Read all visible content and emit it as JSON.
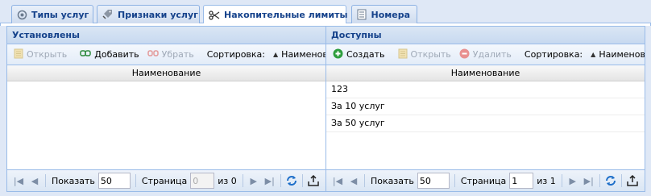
{
  "tabs": [
    {
      "label": "Типы услуг",
      "icon": "gear-icon"
    },
    {
      "label": "Признаки услуг",
      "icon": "tags-icon"
    },
    {
      "label": "Накопительные лимиты",
      "icon": "scissors-icon"
    },
    {
      "label": "Номера",
      "icon": "document-icon"
    }
  ],
  "left": {
    "title": "Установлены",
    "toolbar": {
      "open": "Открыть",
      "add": "Добавить",
      "remove": "Убрать",
      "sort": "Сортировка:",
      "sort_field": "Наименован"
    },
    "column": "Наименование",
    "rows": [],
    "pager": {
      "show": "Показать",
      "page_size": "50",
      "page_label": "Страница",
      "page": "0",
      "of": "из 0"
    }
  },
  "right": {
    "title": "Доступны",
    "toolbar": {
      "create": "Создать",
      "open": "Открыть",
      "delete": "Удалить",
      "sort": "Сортировка:",
      "sort_field": "Наименовани"
    },
    "column": "Наименование",
    "rows": [
      "123",
      "За 10 услуг",
      "За 50 услуг"
    ],
    "pager": {
      "show": "Показать",
      "page_size": "50",
      "page_label": "Страница",
      "page": "1",
      "of": "из 1"
    }
  }
}
